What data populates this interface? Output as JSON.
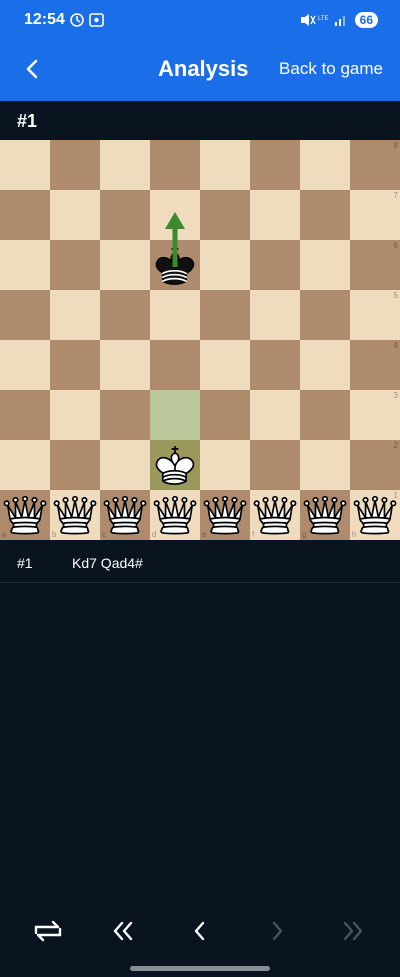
{
  "status": {
    "time": "12:54",
    "battery": "66"
  },
  "app_bar": {
    "title": "Analysis",
    "back_to_game": "Back to game"
  },
  "header": {
    "label": "#1"
  },
  "board": {
    "ranks": [
      "8",
      "7",
      "6",
      "5",
      "4",
      "3",
      "2",
      "1"
    ],
    "files": [
      "a",
      "b",
      "c",
      "d",
      "e",
      "f",
      "g",
      "h"
    ],
    "pieces": [
      {
        "square": "d6",
        "piece": "black-king"
      },
      {
        "square": "d2",
        "piece": "white-king"
      },
      {
        "square": "a1",
        "piece": "white-queen"
      },
      {
        "square": "b1",
        "piece": "white-queen"
      },
      {
        "square": "c1",
        "piece": "white-queen"
      },
      {
        "square": "d1",
        "piece": "white-queen"
      },
      {
        "square": "e1",
        "piece": "white-queen"
      },
      {
        "square": "f1",
        "piece": "white-queen"
      },
      {
        "square": "g1",
        "piece": "white-queen"
      },
      {
        "square": "h1",
        "piece": "white-queen"
      }
    ],
    "highlights": [
      "d3",
      "d2"
    ],
    "arrow": {
      "from": "d6",
      "to": "d7",
      "color": "#3a8a2e"
    }
  },
  "moves": {
    "number": "#1",
    "text": "Kd7 Qad4#"
  },
  "nav": {
    "icons": [
      "flip-board-icon",
      "first-move-icon",
      "previous-move-icon",
      "next-move-icon",
      "last-move-icon"
    ]
  }
}
